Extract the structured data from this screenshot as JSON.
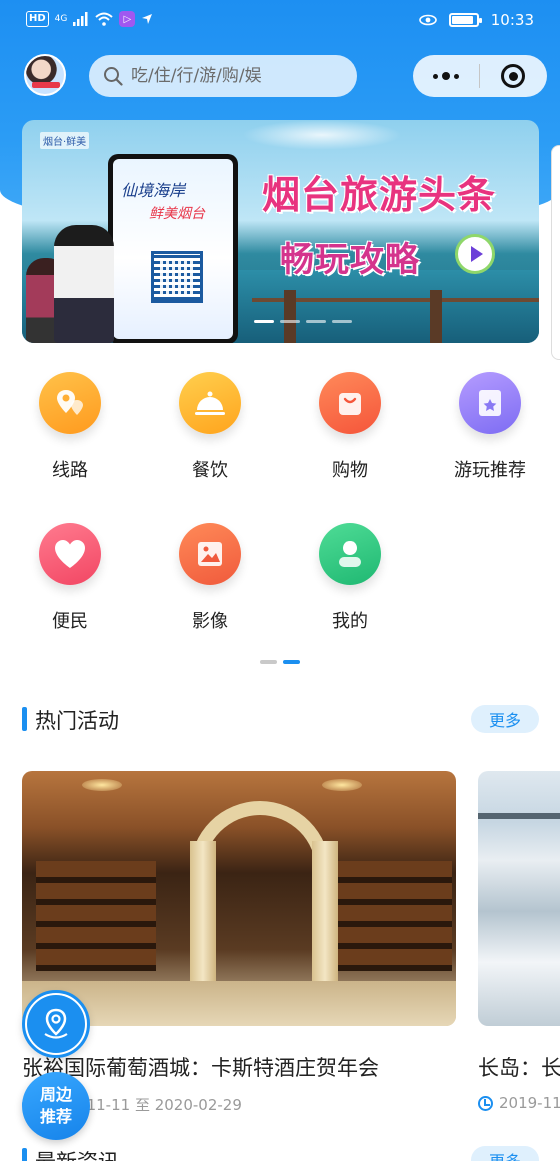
{
  "status_bar": {
    "network": "HD",
    "signal_label": "4G",
    "app_badge_glyph": "▷",
    "time": "10:33",
    "battery_level": 0.82
  },
  "top_bar": {
    "search_placeholder": "吃/住/行/游/购/娱",
    "avatar_icon": "user-avatar",
    "more_icon": "more-dots-icon",
    "close_icon": "target-close-icon"
  },
  "banner": {
    "logo": "烟台·鲜美",
    "screen_title": "仙境海岸",
    "screen_subtitle": "鲜美烟台",
    "headline": "烟台旅游头条",
    "subline": "畅玩攻略",
    "pages": 4,
    "active_page": 1
  },
  "menu": {
    "items": [
      {
        "label": "线路",
        "icon": "map-pin-route-icon",
        "color": "#ffa41d"
      },
      {
        "label": "餐饮",
        "icon": "dining-cloche-icon",
        "color": "#ffa41d"
      },
      {
        "label": "购物",
        "icon": "shopping-bag-icon",
        "color": "#f5553a"
      },
      {
        "label": "游玩推荐",
        "icon": "star-bookmark-icon",
        "color": "#7d6cf3"
      },
      {
        "label": "便民",
        "icon": "heart-icon",
        "color": "#f24663"
      },
      {
        "label": "影像",
        "icon": "image-icon",
        "color": "#f05a3c"
      },
      {
        "label": "我的",
        "icon": "person-icon",
        "color": "#1fb872"
      }
    ],
    "pager_pages": 2,
    "pager_active": 1
  },
  "hot_activities": {
    "title": "热门活动",
    "more_label": "更多",
    "cards": [
      {
        "title": "张裕国际葡萄酒城：卡斯特酒庄贺年会",
        "date": "2019-11-11 至 2020-02-29"
      },
      {
        "title": "长岛：长",
        "date": "2019-11"
      }
    ]
  },
  "floating": {
    "location_icon": "location-pin-icon",
    "nearby_line1": "周边",
    "nearby_line2": "推荐"
  },
  "latest_news": {
    "title": "最新资讯",
    "more_label": "更多"
  },
  "colors": {
    "primary": "#1b8ff0",
    "header_gradient_top": "#1d8ff2",
    "headline_pink": "#e8337f"
  }
}
